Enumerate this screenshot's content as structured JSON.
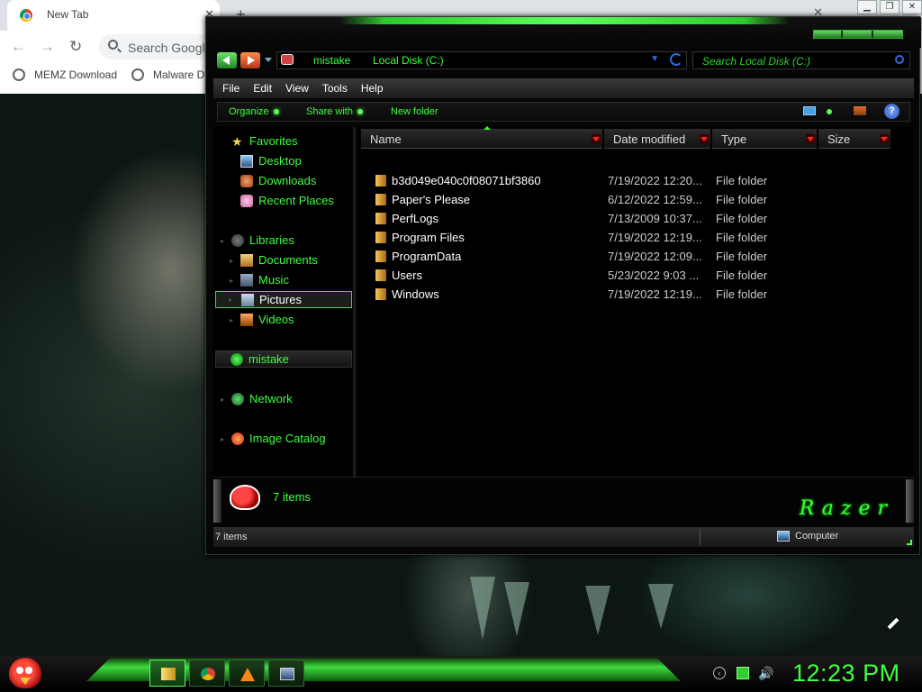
{
  "browser": {
    "tab_title": "New Tab",
    "tab_close": "✕",
    "new_tab": "+",
    "omnibox_placeholder": "Search Google",
    "bookmarks": [
      "MEMZ Download",
      "Malware D"
    ]
  },
  "explorer": {
    "address": {
      "crumbs": [
        "mistake",
        "Local Disk (C:)"
      ]
    },
    "search_placeholder": "Search Local Disk (C:)",
    "menu": [
      "File",
      "Edit",
      "View",
      "Tools",
      "Help"
    ],
    "commands": [
      "Organize",
      "Share with",
      "New folder"
    ],
    "help_glyph": "?",
    "nav": {
      "favorites": "Favorites",
      "favorites_items": [
        "Desktop",
        "Downloads",
        "Recent Places"
      ],
      "libraries": "Libraries",
      "library_items": [
        "Documents",
        "Music",
        "Pictures",
        "Videos"
      ],
      "homegroup": "mistake",
      "network": "Network",
      "image_catalog": "Image Catalog"
    },
    "columns": [
      "Name",
      "Date modified",
      "Type",
      "Size"
    ],
    "files": [
      {
        "name": "b3d049e040c0f08071bf3860",
        "date": "7/19/2022 12:20...",
        "type": "File folder"
      },
      {
        "name": "Paper's Please",
        "date": "6/12/2022 12:59...",
        "type": "File folder"
      },
      {
        "name": "PerfLogs",
        "date": "7/13/2009 10:37...",
        "type": "File folder"
      },
      {
        "name": "Program Files",
        "date": "7/19/2022 12:19...",
        "type": "File folder"
      },
      {
        "name": "ProgramData",
        "date": "7/19/2022 12:09...",
        "type": "File folder"
      },
      {
        "name": "Users",
        "date": "5/23/2022 9:03 ...",
        "type": "File folder"
      },
      {
        "name": "Windows",
        "date": "7/19/2022 12:19...",
        "type": "File folder"
      }
    ],
    "details_count": "7 items",
    "brand": "Razer",
    "status_items": "7 items",
    "status_location": "Computer"
  },
  "taskbar": {
    "clock": "12:23 PM",
    "pinned": [
      "explorer",
      "chrome",
      "vlc",
      "app"
    ]
  },
  "colors": {
    "accent_green": "#3dff3d",
    "background": "#000000"
  }
}
